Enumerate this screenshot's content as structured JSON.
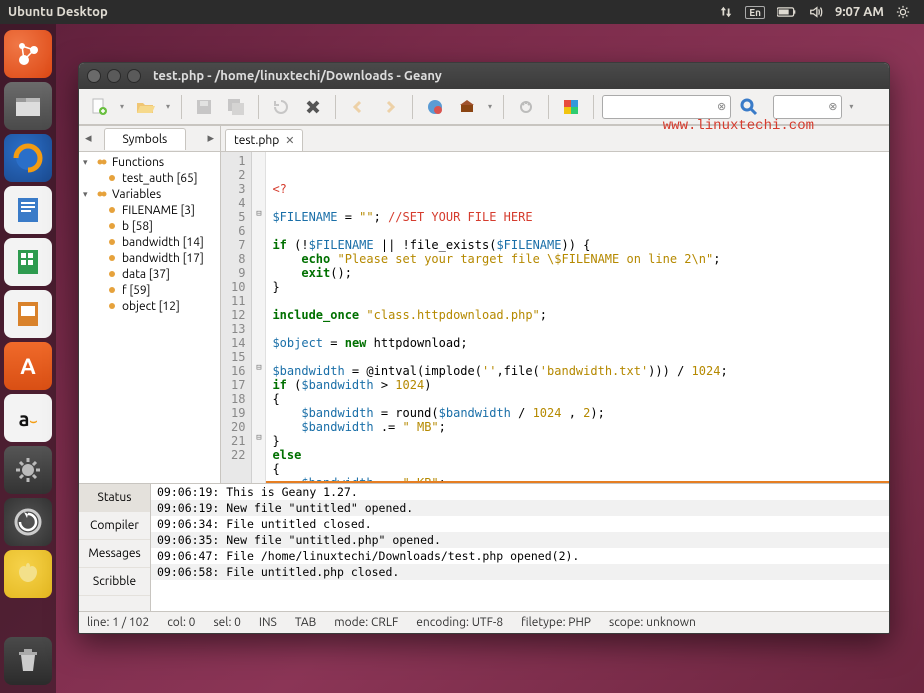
{
  "panel": {
    "title": "Ubuntu Desktop",
    "lang": "En",
    "time": "9:07 AM"
  },
  "window": {
    "title": "test.php - /home/linuxtechi/Downloads - Geany",
    "url_watermark": "www.linuxtechi.com",
    "search1_placeholder": "",
    "search2_placeholder": ""
  },
  "sidebar": {
    "tab": "Symbols",
    "groups": [
      {
        "name": "Functions",
        "items": [
          {
            "label": "test_auth [65]"
          }
        ]
      },
      {
        "name": "Variables",
        "items": [
          {
            "label": "FILENAME [3]"
          },
          {
            "label": "b [58]"
          },
          {
            "label": "bandwidth [14]"
          },
          {
            "label": "bandwidth [17]"
          },
          {
            "label": "data [37]"
          },
          {
            "label": "f [59]"
          },
          {
            "label": "object [12]"
          }
        ]
      }
    ]
  },
  "editor": {
    "tab_label": "test.php",
    "lines": [
      {
        "n": 1,
        "fold": "",
        "html": "<span class='cmt'>&lt;?</span>"
      },
      {
        "n": 2,
        "fold": "",
        "html": ""
      },
      {
        "n": 3,
        "fold": "",
        "html": "<span class='var'>$FILENAME</span> = <span class='str'>\"\"</span>; <span class='cmt'>//SET YOUR FILE HERE</span>"
      },
      {
        "n": 4,
        "fold": "",
        "html": ""
      },
      {
        "n": 5,
        "fold": "⊟",
        "html": "<span class='kw'>if</span> (!<span class='var'>$FILENAME</span> || !file_exists(<span class='var'>$FILENAME</span>)) {"
      },
      {
        "n": 6,
        "fold": "",
        "html": "    <span class='kw'>echo</span> <span class='str'>\"Please set your target file \\$FILENAME on line 2\\n\"</span>;"
      },
      {
        "n": 7,
        "fold": "",
        "html": "    <span class='kw'>exit</span>();"
      },
      {
        "n": 8,
        "fold": "",
        "html": "}"
      },
      {
        "n": 9,
        "fold": "",
        "html": ""
      },
      {
        "n": 10,
        "fold": "",
        "html": "<span class='kw'>include_once</span> <span class='str'>\"class.httpdownload.php\"</span>;"
      },
      {
        "n": 11,
        "fold": "",
        "html": ""
      },
      {
        "n": 12,
        "fold": "",
        "html": "<span class='var'>$object</span> = <span class='kw'>new</span> httpdownload;"
      },
      {
        "n": 13,
        "fold": "",
        "html": ""
      },
      {
        "n": 14,
        "fold": "",
        "html": "<span class='var'>$bandwidth</span> = @intval(implode(<span class='str'>''</span>,file(<span class='str'>'bandwidth.txt'</span>))) / <span class='num'>1024</span>;"
      },
      {
        "n": 15,
        "fold": "",
        "html": "<span class='kw'>if</span> (<span class='var'>$bandwidth</span> &gt; <span class='num'>1024</span>)"
      },
      {
        "n": 16,
        "fold": "⊟",
        "html": "{"
      },
      {
        "n": 17,
        "fold": "",
        "html": "    <span class='var'>$bandwidth</span> = round(<span class='var'>$bandwidth</span> / <span class='num'>1024</span> , <span class='num'>2</span>);"
      },
      {
        "n": 18,
        "fold": "",
        "html": "    <span class='var'>$bandwidth</span> .= <span class='str'>\" MB\"</span>;"
      },
      {
        "n": 19,
        "fold": "",
        "html": "}"
      },
      {
        "n": 20,
        "fold": "",
        "html": "<span class='kw'>else</span>"
      },
      {
        "n": 21,
        "fold": "⊟",
        "html": "{"
      },
      {
        "n": 22,
        "fold": "",
        "html": "    <span class='var'>$bandwidth</span> .= <span class='str'>\" KB\"</span>;"
      }
    ]
  },
  "messages": {
    "tabs": [
      "Status",
      "Compiler",
      "Messages",
      "Scribble"
    ],
    "active": 0,
    "rows": [
      "09:06:19: This is Geany 1.27.",
      "09:06:19: New file \"untitled\" opened.",
      "09:06:34: File untitled closed.",
      "09:06:35: New file \"untitled.php\" opened.",
      "09:06:47: File /home/linuxtechi/Downloads/test.php opened(2).",
      "09:06:58: File untitled.php closed."
    ]
  },
  "statusbar": {
    "line": "line: 1 / 102",
    "col": "col: 0",
    "sel": "sel: 0",
    "ins": "INS",
    "tab": "TAB",
    "mode": "mode: CRLF",
    "encoding": "encoding: UTF-8",
    "filetype": "filetype: PHP",
    "scope": "scope: unknown"
  }
}
